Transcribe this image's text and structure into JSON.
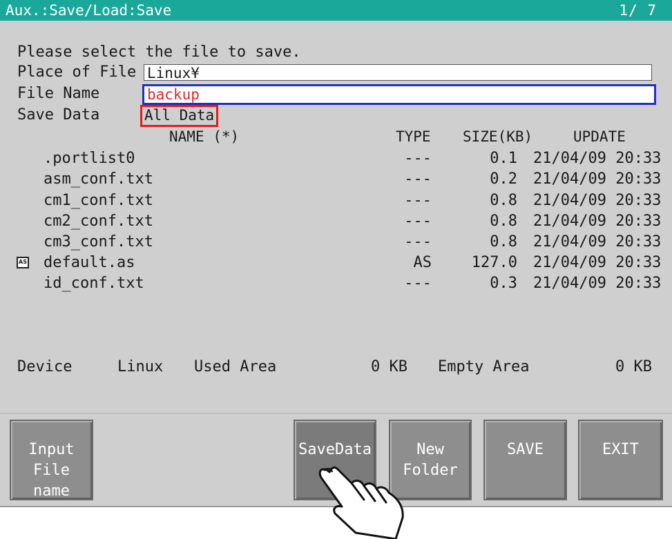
{
  "title_bar": {
    "title": "Aux.:Save/Load:Save",
    "page": "1/  7"
  },
  "prompt": "Please select the file to save.",
  "place_of_file": {
    "label": "Place of File",
    "value": "Linux¥"
  },
  "file_name": {
    "label": "File Name",
    "value": "backup"
  },
  "save_data": {
    "label": "Save Data",
    "value": "All Data"
  },
  "columns": {
    "name": "NAME  (*)",
    "type": "TYPE",
    "size": "SIZE(KB)",
    "update": "UPDATE"
  },
  "files": [
    {
      "icon": "",
      "name": ".portlist0",
      "type": "---",
      "size": "0.1",
      "update": "21/04/09 20:33"
    },
    {
      "icon": "",
      "name": "asm_conf.txt",
      "type": "---",
      "size": "0.2",
      "update": "21/04/09 20:33"
    },
    {
      "icon": "",
      "name": "cm1_conf.txt",
      "type": "---",
      "size": "0.8",
      "update": "21/04/09 20:33"
    },
    {
      "icon": "",
      "name": "cm2_conf.txt",
      "type": "---",
      "size": "0.8",
      "update": "21/04/09 20:33"
    },
    {
      "icon": "",
      "name": "cm3_conf.txt",
      "type": "---",
      "size": "0.8",
      "update": "21/04/09 20:33"
    },
    {
      "icon": "AS",
      "name": "default.as",
      "type": "AS",
      "size": "127.0",
      "update": "21/04/09 20:33"
    },
    {
      "icon": "",
      "name": "id_conf.txt",
      "type": "---",
      "size": "0.3",
      "update": "21/04/09 20:33"
    }
  ],
  "device_info": {
    "device_label": "Device",
    "device_value": "Linux",
    "used_label": "Used Area",
    "used_value": "0 KB",
    "empty_label": "Empty Area",
    "empty_value": "0 KB"
  },
  "buttons": {
    "input_line1": "Input",
    "input_line2": "File name",
    "savedata": "SaveData",
    "newfolder_line1": "New",
    "newfolder_line2": "Folder",
    "save": "SAVE",
    "exit": "EXIT"
  },
  "colors": {
    "title_bar": "#1aa89a",
    "file_name_border": "#1e2fc8",
    "file_name_text": "#e0282d",
    "save_data_highlight": "#e21b1b",
    "button": "#8e8e8e"
  },
  "icons": {
    "file_type": "as-file-icon",
    "pointer": "pointing-hand-icon"
  }
}
